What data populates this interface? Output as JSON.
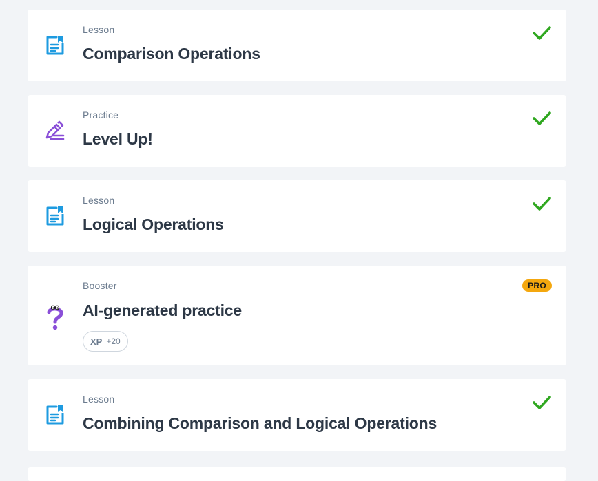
{
  "items": [
    {
      "type": "lesson",
      "kind": "Lesson",
      "title": "Comparison Operations",
      "status": "completed",
      "icon": "lesson-document-icon"
    },
    {
      "type": "practice",
      "kind": "Practice",
      "title": "Level Up!",
      "status": "completed",
      "icon": "practice-pencil-icon"
    },
    {
      "type": "lesson",
      "kind": "Lesson",
      "title": "Logical Operations",
      "status": "completed",
      "icon": "lesson-document-icon"
    },
    {
      "type": "booster",
      "kind": "Booster",
      "title": "AI-generated practice",
      "badge": "PRO",
      "xp_label": "XP",
      "xp_value": "+20",
      "icon": "booster-question-icon"
    },
    {
      "type": "lesson",
      "kind": "Lesson",
      "title": "Combining Comparison and Logical Operations",
      "status": "completed",
      "icon": "lesson-document-icon"
    }
  ],
  "colors": {
    "background": "#f2f4f7",
    "card": "#ffffff",
    "lesson_icon": "#1e9be0",
    "practice_icon": "#8a4fd8",
    "check": "#2fa71f",
    "pro_badge": "#f4a70e",
    "title_text": "#2d3846",
    "kind_text": "#6b7b8e"
  }
}
